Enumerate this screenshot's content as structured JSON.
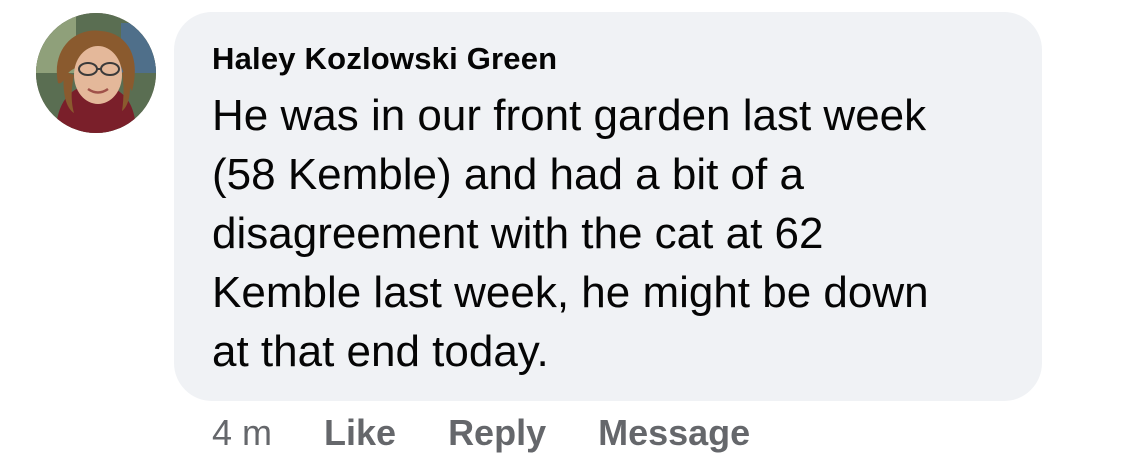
{
  "comment": {
    "author": "Haley Kozlowski Green",
    "lines": [
      "He was in our front garden last week",
      "(58 Kemble) and had a bit of a",
      "disagreement with the cat at 62",
      "Kemble last week, he might be down",
      "at that end today."
    ],
    "timestamp": "4 m",
    "actions": {
      "like": "Like",
      "reply": "Reply",
      "message": "Message"
    }
  },
  "colors": {
    "bubble": "#f0f2f5",
    "text": "#050505",
    "secondary": "#65676b"
  }
}
